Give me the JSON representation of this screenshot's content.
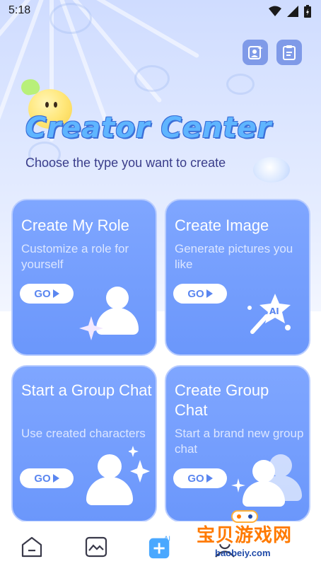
{
  "status": {
    "time": "5:18"
  },
  "header": {
    "title": "Creator Center",
    "subtitle": "Choose the type you want to create",
    "icons": [
      "add-contact-icon",
      "clipboard-icon"
    ]
  },
  "cards": [
    {
      "title": "Create My Role",
      "desc": "Customize a role for yourself",
      "go": "GO"
    },
    {
      "title": "Create Image",
      "desc": "Generate pictures you like",
      "go": "GO",
      "badge": "AI"
    },
    {
      "title": "Start a Group Chat",
      "desc": "Use created characters",
      "go": "GO"
    },
    {
      "title": "Create Group Chat",
      "desc": "Start a brand new group chat",
      "go": "GO"
    }
  ],
  "nav": {
    "items": [
      "home-icon",
      "gallery-icon",
      "create-ai-icon",
      "profile-icon"
    ],
    "ai_badge": "AI"
  },
  "watermark": {
    "text": "宝贝游戏网",
    "url": "baobeiy.com"
  },
  "colors": {
    "card": "#7fa6ff",
    "accent": "#5a86f0",
    "title": "#5fb5ff"
  }
}
